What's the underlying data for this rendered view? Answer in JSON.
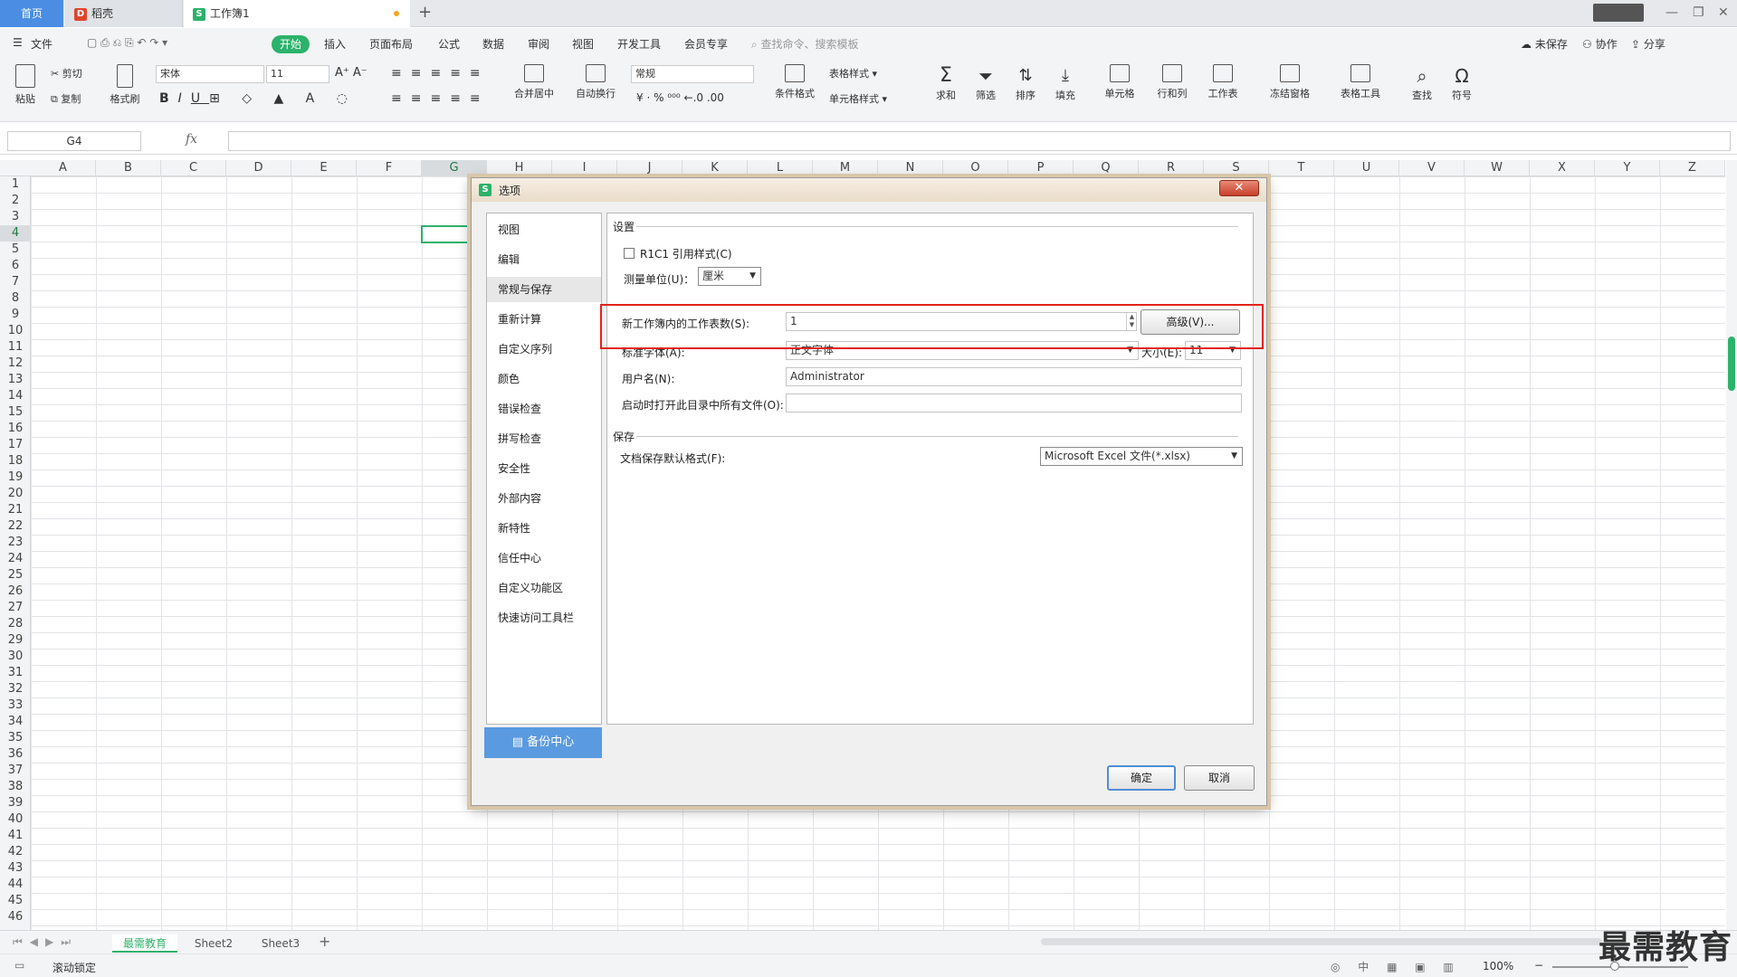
{
  "titlebar": {
    "tabs": [
      {
        "label": "首页"
      },
      {
        "label": "稻壳"
      },
      {
        "label": "工作簿1"
      }
    ]
  },
  "menubar": {
    "file": "文件",
    "items": [
      "开始",
      "插入",
      "页面布局",
      "公式",
      "数据",
      "审阅",
      "视图",
      "开发工具",
      "会员专享"
    ],
    "search_placeholder": "查找命令、搜索模板",
    "right": [
      "未保存",
      "协作",
      "分享"
    ]
  },
  "ribbon": {
    "paste": "粘贴",
    "cut": "剪切",
    "copy": "复制",
    "format_painter": "格式刷",
    "font_name": "宋体",
    "font_size": "11",
    "merge_center": "合并居中",
    "wrap": "自动换行",
    "number_format": "常规",
    "cond_format": "条件格式",
    "table_style": "表格样式",
    "cell_style": "单元格样式",
    "sum": "求和",
    "filter": "筛选",
    "sort": "排序",
    "fill": "填充",
    "cell": "单元格",
    "rowcol": "行和列",
    "sheet": "工作表",
    "freeze": "冻结窗格",
    "table_tools": "表格工具",
    "find": "查找",
    "symbol": "符号"
  },
  "formula": {
    "namebox": "G4",
    "fx": "fx"
  },
  "columns": [
    "A",
    "B",
    "C",
    "D",
    "E",
    "F",
    "G",
    "H",
    "I",
    "J",
    "K",
    "L",
    "M",
    "N",
    "O",
    "P",
    "Q",
    "R",
    "S",
    "T",
    "U",
    "V",
    "W",
    "X",
    "Y",
    "Z"
  ],
  "rows": [
    "1",
    "2",
    "3",
    "4",
    "5",
    "6",
    "7",
    "8",
    "9",
    "10",
    "11",
    "12",
    "13",
    "14",
    "15",
    "16",
    "17",
    "18",
    "19",
    "20",
    "21",
    "22",
    "23",
    "24",
    "25",
    "26",
    "27",
    "28",
    "29",
    "30",
    "31",
    "32",
    "33",
    "34",
    "35",
    "36",
    "37",
    "38",
    "39",
    "40",
    "41",
    "42",
    "43",
    "44",
    "45",
    "46"
  ],
  "sheets": [
    "最需教育",
    "Sheet2",
    "Sheet3"
  ],
  "status": {
    "scroll_lock": "滚动锁定",
    "zoom": "100%"
  },
  "dialog": {
    "title": "选项",
    "nav": [
      "视图",
      "编辑",
      "常规与保存",
      "重新计算",
      "自定义序列",
      "颜色",
      "错误检查",
      "拼写检查",
      "安全性",
      "外部内容",
      "新特性",
      "信任中心",
      "自定义功能区",
      "快速访问工具栏"
    ],
    "backup": "备份中心",
    "settings_label": "设置",
    "r1c1": "R1C1 引用样式(C)",
    "unit_label": "测量单位(U)：",
    "unit_value": "厘米",
    "sheets_label": "新工作簿内的工作表数(S):",
    "sheets_value": "1",
    "advanced": "高级(V)...",
    "std_font_label": "标准字体(A):",
    "std_font_value": "正文字体",
    "size_label": "大小(E):",
    "size_value": "11",
    "username_label": "用户名(N):",
    "username_value": "Administrator",
    "startup_label": "启动时打开此目录中所有文件(O):",
    "startup_value": "",
    "save_label": "保存",
    "save_format_label": "文档保存默认格式(F):",
    "save_format_value": "Microsoft Excel 文件(*.xlsx)",
    "ok": "确定",
    "cancel": "取消"
  },
  "watermark": "最需教育",
  "colors": {
    "accent": "#2cb26b",
    "highlight": "#e2231a",
    "home_tab": "#4a8de3"
  }
}
